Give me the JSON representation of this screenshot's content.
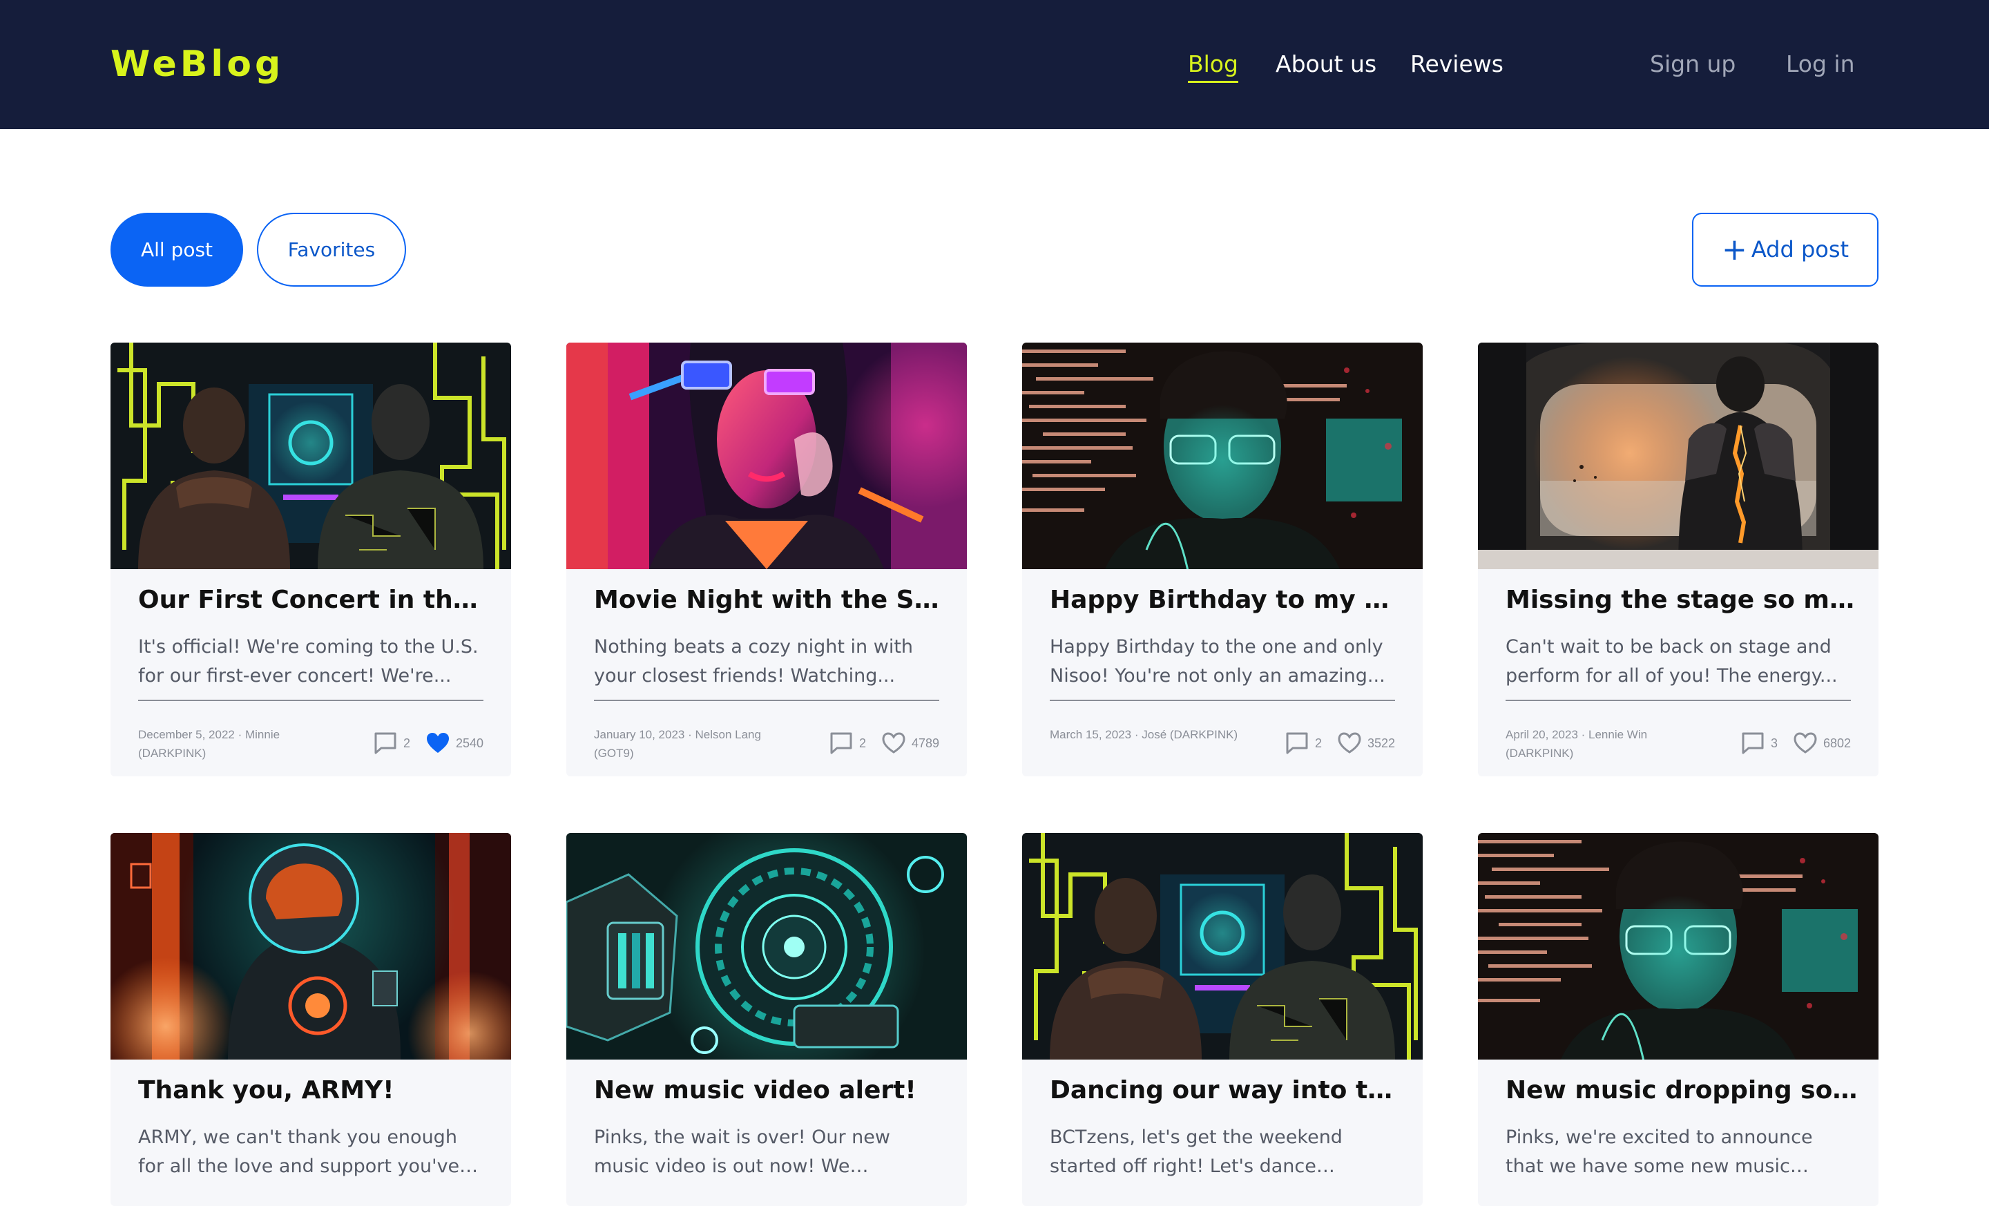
{
  "header": {
    "logo": "WeBlog",
    "nav": [
      {
        "label": "Blog",
        "active": true
      },
      {
        "label": "About us",
        "active": false
      },
      {
        "label": "Reviews",
        "active": false
      }
    ],
    "signup": "Sign up",
    "login": "Log in"
  },
  "filters": {
    "all_post": "All post",
    "favorites": "Favorites",
    "add_post": "Add post"
  },
  "colors": {
    "header_bg": "#151d3b",
    "accent_yellow": "#d8f31c",
    "primary_blue": "#0b64f4",
    "liked_heart": "#0b64f4"
  },
  "posts": [
    {
      "title": "Our First Concert in the...",
      "excerpt": "It's official! We're coming to the U.S. for our first-ever concert! We're...",
      "meta": "December 5, 2022 · Minnie (DARKPINK)",
      "comments": "2",
      "likes": "2540",
      "liked": true,
      "image": "two-figures-neon-maze"
    },
    {
      "title": "Movie Night with the Squad",
      "excerpt": "Nothing beats a cozy night in with your closest friends! Watching...",
      "meta": "January 10, 2023 · Nelson Lang (GOT9)",
      "comments": "2",
      "likes": "4789",
      "liked": false,
      "image": "neon-glasses-woman"
    },
    {
      "title": "Happy Birthday to my best...",
      "excerpt": "Happy Birthday to the one and only Nisoo! You're not only an amazing...",
      "meta": "March 15, 2023 · José (DARKPINK)",
      "comments": "2",
      "likes": "3522",
      "liked": false,
      "image": "glasses-man-data-streams"
    },
    {
      "title": "Missing the stage so much!",
      "excerpt": "Can't wait to be back on stage and perform for all of you! The energy...",
      "meta": "April 20, 2023 · Lennie Win (DARKPINK)",
      "comments": "3",
      "likes": "6802",
      "liked": false,
      "image": "armored-figure-window"
    },
    {
      "title": "Thank you, ARMY!",
      "excerpt": "ARMY, we can't thank you enough for all the love and support you've sho...",
      "image": "astronaut-neon-fire"
    },
    {
      "title": "New music video alert!",
      "excerpt": "Pinks, the wait is over! Our new music video is out now! We worked...",
      "image": "cyber-machine-teal"
    },
    {
      "title": "Dancing our way into the...",
      "excerpt": "BCTzens, let's get the weekend started off right! Let's dance togeth...",
      "image": "two-figures-neon-maze"
    },
    {
      "title": "New music dropping soon!...",
      "excerpt": "Pinks, we're excited to announce that we have some new music coming...",
      "image": "glasses-man-data-streams"
    }
  ]
}
